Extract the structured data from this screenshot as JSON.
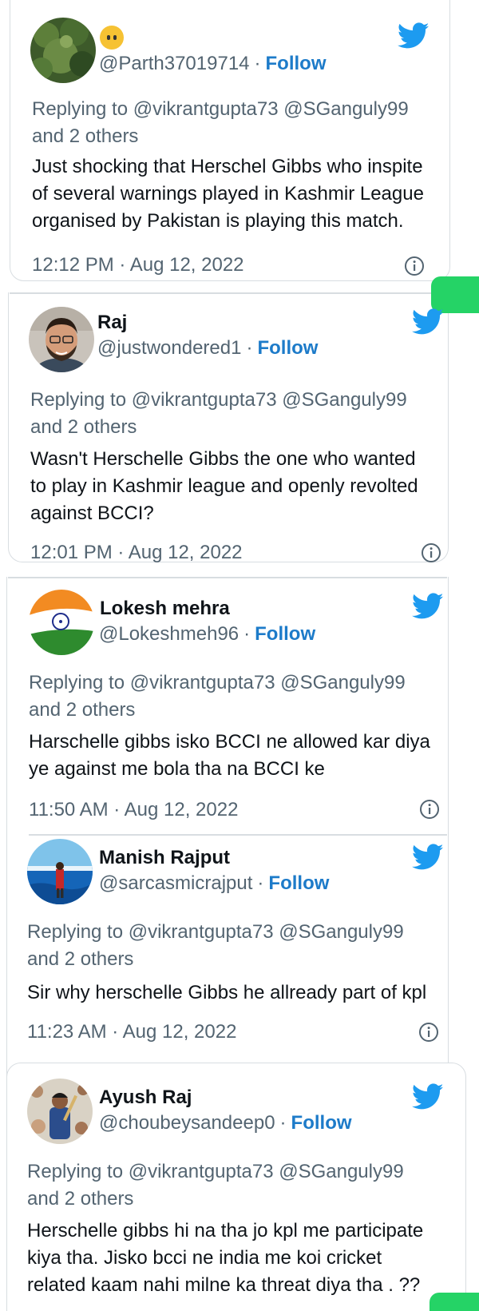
{
  "tweets": [
    {
      "name": "",
      "handle": "@Parth37019714",
      "separator": "·",
      "follow": "Follow",
      "replying": "Replying to @vikrantgupta73 @SGanguly99 and 2 others",
      "text_lines": [
        "Just shocking that Herschel Gibbs who inspite",
        "of several warnings played in Kashmir League",
        "organised by Pakistan is playing this match."
      ],
      "timestamp": "12:12 PM · Aug 12, 2022"
    },
    {
      "name": "Raj",
      "handle": "@justwondered1",
      "separator": "·",
      "follow": "Follow",
      "replying": "Replying to @vikrantgupta73 @SGanguly99 and 2 others",
      "text_lines": [
        "Wasn't Herschelle Gibbs the one who wanted",
        "to play in Kashmir league and openly revolted",
        "against BCCI?"
      ],
      "timestamp": "12:01 PM · Aug 12, 2022"
    },
    {
      "name": "Lokesh mehra",
      "handle": "@Lokeshmeh96",
      "separator": "·",
      "follow": "Follow",
      "replying": "Replying to @vikrantgupta73 @SGanguly99 and 2 others",
      "text_lines": [
        "Harschelle gibbs isko BCCI ne allowed kar diya",
        "ye against me bola tha na BCCI ke"
      ],
      "timestamp": "11:50 AM · Aug 12, 2022"
    },
    {
      "name": "Manish Rajput",
      "handle": "@sarcasmicrajput",
      "separator": "·",
      "follow": "Follow",
      "replying": "Replying to @vikrantgupta73 @SGanguly99 and 2 others",
      "text_lines": [
        "Sir why herschelle Gibbs he allready part of kpl"
      ],
      "timestamp": "11:23 AM · Aug 12, 2022"
    },
    {
      "name": "Ayush Raj",
      "handle": "@choubeysandeep0",
      "separator": "·",
      "follow": "Follow",
      "replying": "Replying to @vikrantgupta73 @SGanguly99 and 2 others",
      "text_lines": [
        "Herschelle gibbs hi na tha jo kpl me participate",
        "kiya tha. Jisko bcci ne india me koi cricket",
        "related kaam nahi milne ka threat diya tha . ??"
      ],
      "timestamp": ""
    }
  ],
  "colors": {
    "twitter_blue": "#1d9bf0",
    "follow_blue": "#1d7bc9",
    "secondary_text": "#536471",
    "whatsapp_green": "#25d366"
  },
  "icons": [
    "twitter-bird-icon",
    "info-icon",
    "whatsapp-icon"
  ]
}
